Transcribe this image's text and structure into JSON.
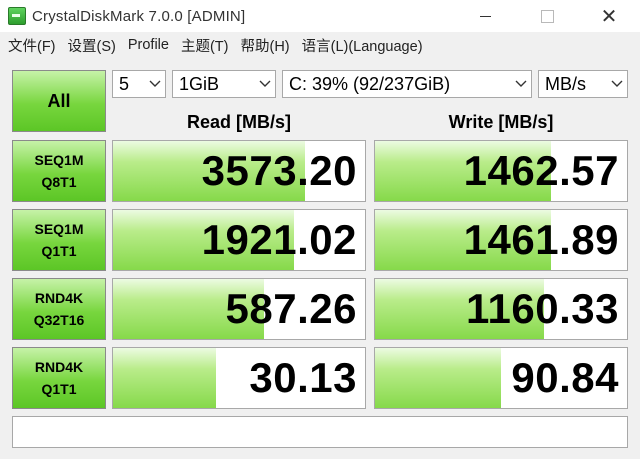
{
  "window": {
    "title": "CrystalDiskMark 7.0.0  [ADMIN]",
    "controls": {
      "minimize": "—",
      "maximize": "☐",
      "close": "✕"
    }
  },
  "menu": {
    "items": [
      "文件(F)",
      "设置(S)",
      "Profile",
      "主题(T)",
      "帮助(H)",
      "语言(L)(Language)"
    ]
  },
  "toolbar": {
    "all_label": "All",
    "count": "5",
    "size": "1GiB",
    "drive": "C: 39% (92/237GiB)",
    "unit": "MB/s"
  },
  "headers": {
    "read": "Read [MB/s]",
    "write": "Write [MB/s]"
  },
  "rows": [
    {
      "line1": "SEQ1M",
      "line2": "Q8T1",
      "read": "3573.20",
      "write": "1462.57",
      "read_level": 0.76,
      "write_level": 0.7
    },
    {
      "line1": "SEQ1M",
      "line2": "Q1T1",
      "read": "1921.02",
      "write": "1461.89",
      "read_level": 0.72,
      "write_level": 0.7
    },
    {
      "line1": "RND4K",
      "line2": "Q32T16",
      "read": "587.26",
      "write": "1160.33",
      "read_level": 0.6,
      "write_level": 0.67
    },
    {
      "line1": "RND4K",
      "line2": "Q1T1",
      "read": "30.13",
      "write": "90.84",
      "read_level": 0.41,
      "write_level": 0.5
    }
  ],
  "comment": "",
  "colors": {
    "accent_green": "#78d63e",
    "bar_green": "#86d94a"
  }
}
